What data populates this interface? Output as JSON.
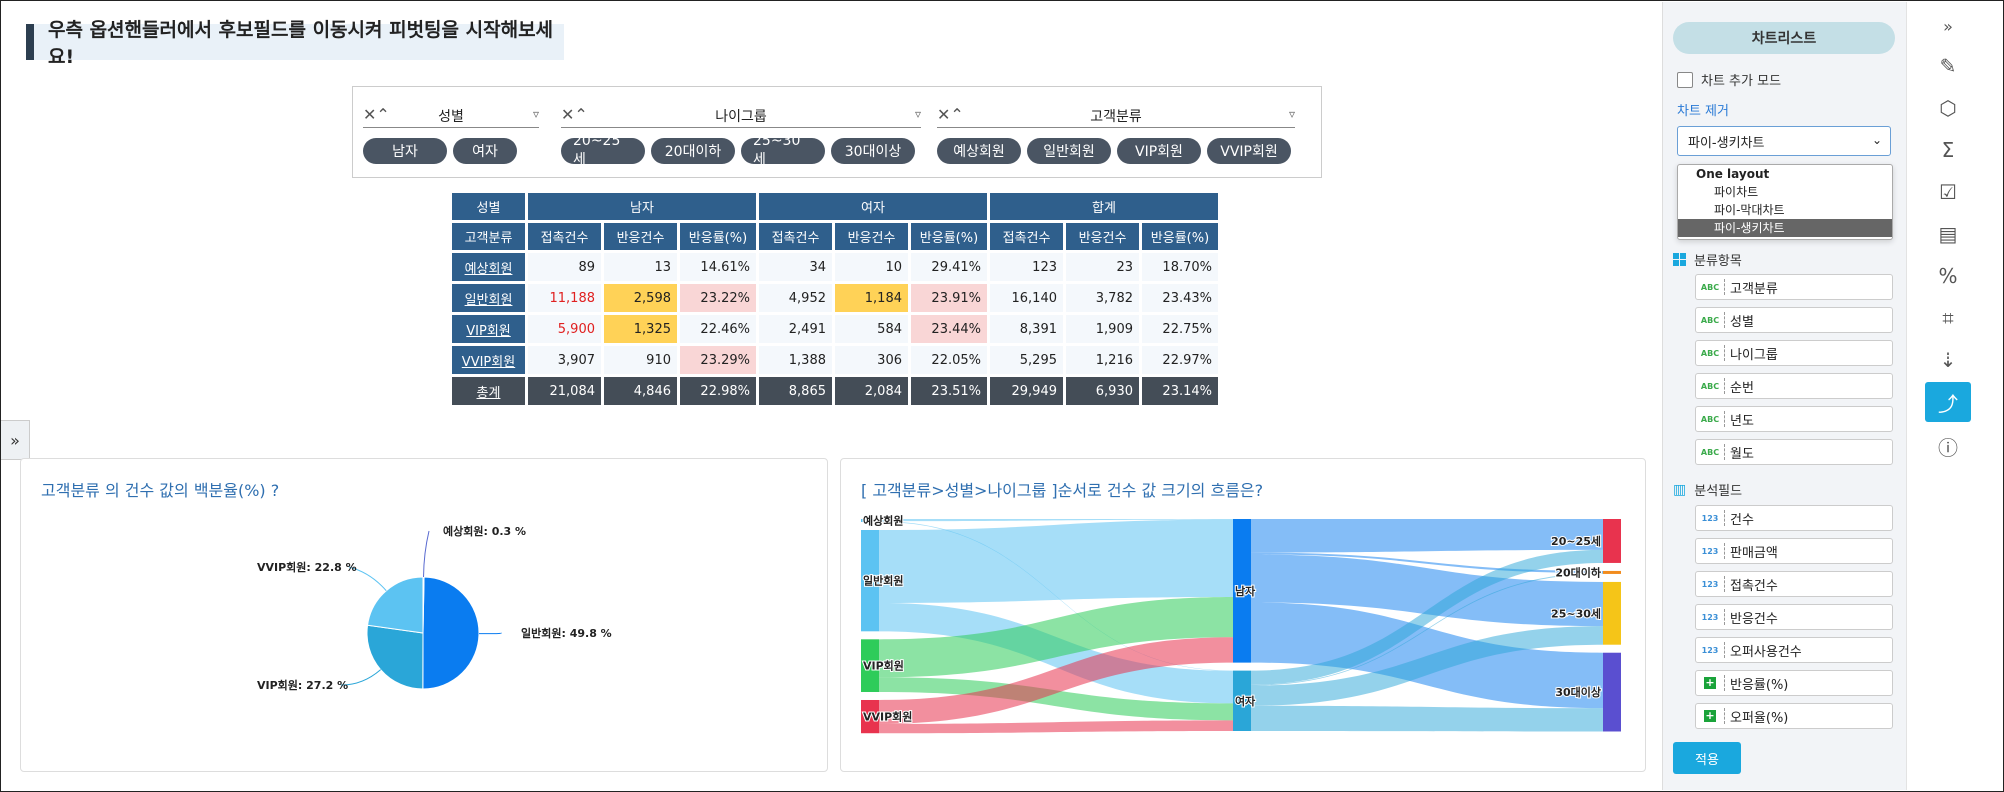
{
  "banner": "우측 옵션핸들러에서 후보필드를 이동시켜 피벗팅을 시작해보세요!",
  "filters": [
    {
      "name": "성별",
      "chips": [
        "남자",
        "여자"
      ]
    },
    {
      "name": "나이그룹",
      "chips": [
        "20~25세",
        "20대이하",
        "25~30세",
        "30대이상"
      ]
    },
    {
      "name": "고객분류",
      "chips": [
        "예상회원",
        "일반회원",
        "VIP회원",
        "VVIP회원"
      ]
    }
  ],
  "pivot": {
    "corner": "성별",
    "groups": [
      "남자",
      "여자",
      "합계"
    ],
    "row_label_header": "고객분류",
    "sub_headers": [
      "접촉건수",
      "반응건수",
      "반응률(%)",
      "접촉건수",
      "반응건수",
      "반응률(%)",
      "접촉건수",
      "반응건수",
      "반응률(%)"
    ],
    "rows": [
      {
        "label": "예상회원",
        "cells": [
          "89",
          "13",
          "14.61%",
          "34",
          "10",
          "29.41%",
          "123",
          "23",
          "18.70%"
        ]
      },
      {
        "label": "일반회원",
        "cells": [
          "11,188",
          "2,598",
          "23.22%",
          "4,952",
          "1,184",
          "23.91%",
          "16,140",
          "3,782",
          "23.43%"
        ]
      },
      {
        "label": "VIP회원",
        "cells": [
          "5,900",
          "1,325",
          "22.46%",
          "2,491",
          "584",
          "23.44%",
          "8,391",
          "1,909",
          "22.75%"
        ]
      },
      {
        "label": "VVIP회원",
        "cells": [
          "3,907",
          "910",
          "23.29%",
          "1,388",
          "306",
          "22.05%",
          "5,295",
          "1,216",
          "22.97%"
        ]
      }
    ],
    "total": {
      "label": "총계",
      "cells": [
        "21,084",
        "4,846",
        "22.98%",
        "8,865",
        "2,084",
        "23.51%",
        "29,949",
        "6,930",
        "23.14%"
      ]
    }
  },
  "charts": {
    "pie_title": "고객분류 의 건수 값의 백분율(%) ?",
    "sankey_title": "[ 고객분류>성별>나이그룹 ]순서로 건수 값 크기의 흐름은?"
  },
  "chart_data": [
    {
      "type": "pie",
      "slices": [
        {
          "label": "일반회원: 49.8 %",
          "name": "일반회원",
          "value": 49.8,
          "color": "#0a7cf0"
        },
        {
          "label": "VIP회원: 27.2 %",
          "name": "VIP회원",
          "value": 27.2,
          "color": "#2aa6d8"
        },
        {
          "label": "VVIP회원: 22.8 %",
          "name": "VVIP회원",
          "value": 22.8,
          "color": "#5cc3f2"
        },
        {
          "label": "예상회원: 0.3 %",
          "name": "예상회원",
          "value": 0.3,
          "color": "#5a6bd0"
        }
      ]
    },
    {
      "type": "sankey",
      "stages": [
        [
          {
            "name": "예상회원",
            "value": 123,
            "color": "#5cc3f2"
          },
          {
            "name": "일반회원",
            "value": 16140,
            "color": "#5cc3f2"
          },
          {
            "name": "VIP회원",
            "value": 8391,
            "color": "#2ecc5a"
          },
          {
            "name": "VVIP회원",
            "value": 5295,
            "color": "#e8334e"
          }
        ],
        [
          {
            "name": "남자",
            "value": 21084,
            "color": "#0a7cf0"
          },
          {
            "name": "여자",
            "value": 8865,
            "color": "#2aa6d8"
          }
        ],
        [
          {
            "name": "20~25세",
            "value": 7000,
            "color": "#e8334e"
          },
          {
            "name": "20대이하",
            "value": 400,
            "color": "#f28c1e"
          },
          {
            "name": "25~30세",
            "value": 10000,
            "color": "#f5c518"
          },
          {
            "name": "30대이상",
            "value": 12549,
            "color": "#5a4fd0"
          }
        ]
      ]
    }
  ],
  "sidebar": {
    "title": "차트리스트",
    "add_mode": "차트 추가 모드",
    "remove": "차트 제거",
    "selected": "파이-생키차트",
    "dropdown_group": "One layout",
    "dropdown_options": [
      "파이차트",
      "파이-막대차트",
      "파이-생키차트"
    ],
    "category_header": "분류항목",
    "category_fields": [
      "고객분류",
      "성별",
      "나이그룹",
      "순번",
      "년도",
      "월도"
    ],
    "analysis_header": "분석필드",
    "numeric_fields": [
      "건수",
      "판매금액",
      "접촉건수",
      "반응건수",
      "오퍼사용건수"
    ],
    "calc_fields": [
      "반응률(%)",
      "오퍼율(%)"
    ],
    "apply": "적용",
    "abc_tag": "ABC",
    "num_tag": "123"
  }
}
